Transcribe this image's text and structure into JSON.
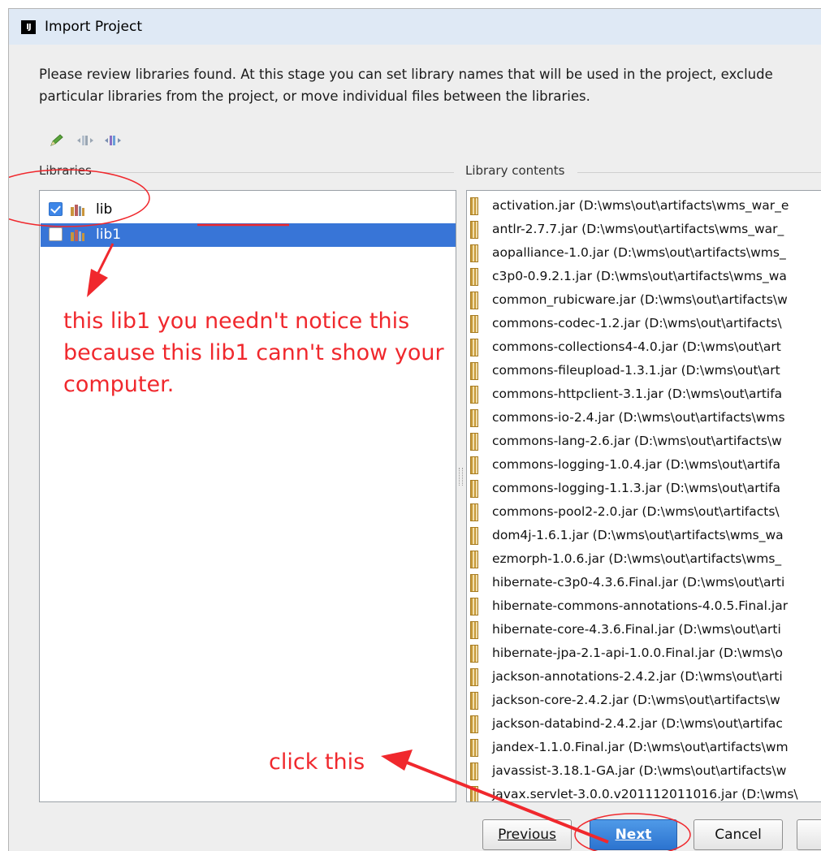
{
  "window": {
    "title": "Import Project",
    "app_icon_text": "IJ"
  },
  "description": "Please review libraries found. At this stage you can set library names that will be used in the project, exclude particular libraries from the project, or move individual files between the libraries.",
  "toolbar": {
    "icons": [
      "edit-pencil-icon",
      "merge-libraries-icon",
      "split-library-icon"
    ]
  },
  "libraries": {
    "label": "Libraries",
    "items": [
      {
        "name": "lib",
        "checked": true,
        "selected": false
      },
      {
        "name": "lib1",
        "checked": false,
        "selected": true
      }
    ]
  },
  "library_contents": {
    "label": "Library contents",
    "items": [
      "activation.jar (D:\\wms\\out\\artifacts\\wms_war_e",
      "antlr-2.7.7.jar (D:\\wms\\out\\artifacts\\wms_war_",
      "aopalliance-1.0.jar (D:\\wms\\out\\artifacts\\wms_",
      "c3p0-0.9.2.1.jar (D:\\wms\\out\\artifacts\\wms_wa",
      "common_rubicware.jar (D:\\wms\\out\\artifacts\\w",
      "commons-codec-1.2.jar (D:\\wms\\out\\artifacts\\",
      "commons-collections4-4.0.jar (D:\\wms\\out\\art",
      "commons-fileupload-1.3.1.jar (D:\\wms\\out\\art",
      "commons-httpclient-3.1.jar (D:\\wms\\out\\artifa",
      "commons-io-2.4.jar (D:\\wms\\out\\artifacts\\wms",
      "commons-lang-2.6.jar (D:\\wms\\out\\artifacts\\w",
      "commons-logging-1.0.4.jar (D:\\wms\\out\\artifa",
      "commons-logging-1.1.3.jar (D:\\wms\\out\\artifa",
      "commons-pool2-2.0.jar (D:\\wms\\out\\artifacts\\",
      "dom4j-1.6.1.jar (D:\\wms\\out\\artifacts\\wms_wa",
      "ezmorph-1.0.6.jar (D:\\wms\\out\\artifacts\\wms_",
      "hibernate-c3p0-4.3.6.Final.jar (D:\\wms\\out\\arti",
      "hibernate-commons-annotations-4.0.5.Final.jar",
      "hibernate-core-4.3.6.Final.jar (D:\\wms\\out\\arti",
      "hibernate-jpa-2.1-api-1.0.0.Final.jar (D:\\wms\\o",
      "jackson-annotations-2.4.2.jar (D:\\wms\\out\\arti",
      "jackson-core-2.4.2.jar (D:\\wms\\out\\artifacts\\w",
      "jackson-databind-2.4.2.jar (D:\\wms\\out\\artifac",
      "jandex-1.1.0.Final.jar (D:\\wms\\out\\artifacts\\wm",
      "javassist-3.18.1-GA.jar (D:\\wms\\out\\artifacts\\w",
      "javax.servlet-3.0.0.v201112011016.jar (D:\\wms\\"
    ]
  },
  "annotations": {
    "note_lines": [
      "this lib1 you needn't notice this",
      "because this lib1 cann't show your",
      "computer."
    ],
    "click_hint": "click this",
    "color": "#f0282d"
  },
  "buttons": {
    "previous": "Previous",
    "next": "Next",
    "cancel": "Cancel"
  },
  "colors": {
    "selection": "#3875d7",
    "titlebar": "#dfe9f5",
    "primary_button": "#2c73cf"
  }
}
